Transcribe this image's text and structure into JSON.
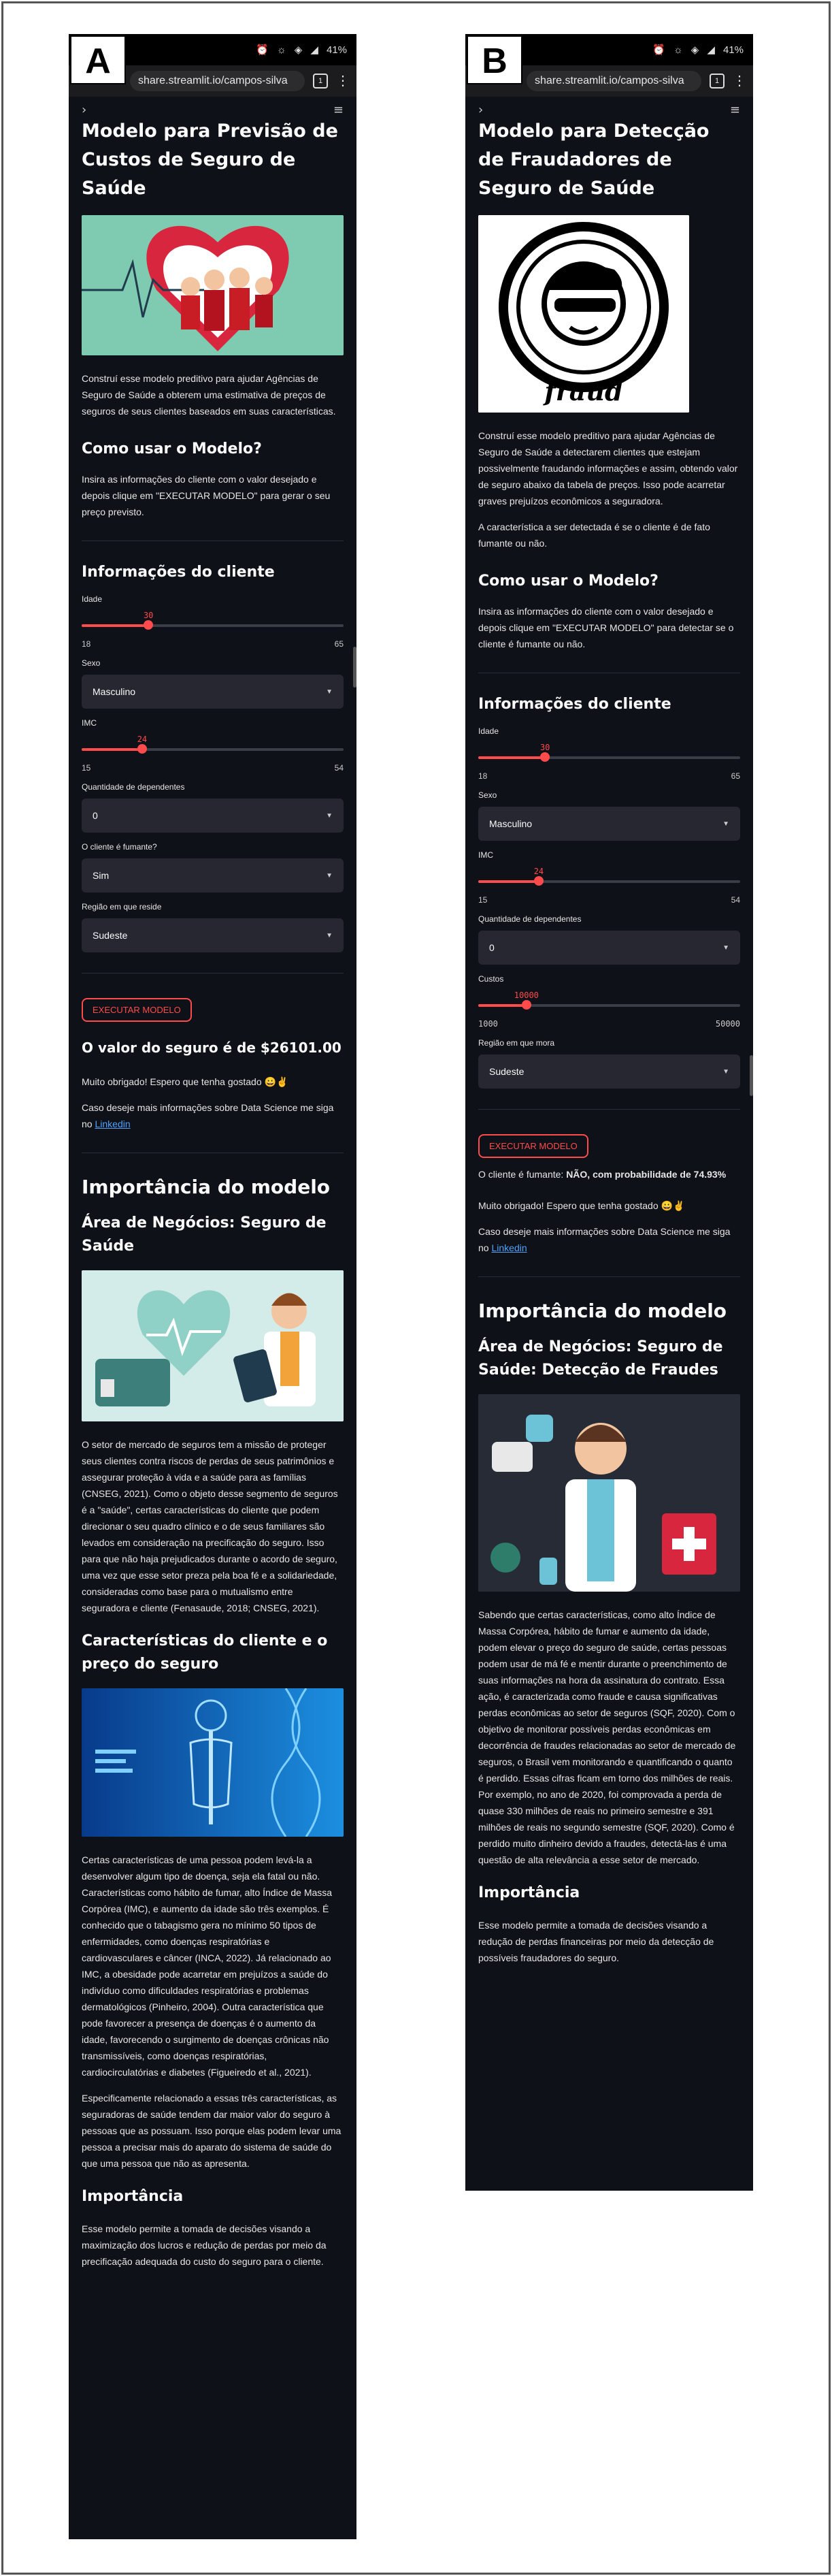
{
  "labels": {
    "a": "A",
    "b": "B"
  },
  "status": {
    "battery": "41%"
  },
  "browser": {
    "url": "share.streamlit.io/campos-silva",
    "tab_count": "1"
  },
  "a": {
    "title": "Modelo para Previsão de Custos de Seguro de Saúde",
    "intro": "Construí esse modelo preditivo para ajudar Agências de Seguro de Saúde a obterem uma estimativa de preços de seguros de seus clientes baseados em suas características.",
    "how_title": "Como usar o Modelo?",
    "how_text": "Insira as informações do cliente com o valor desejado e depois clique em \"EXECUTAR MODELO\" para gerar o seu preço previsto.",
    "info_title": "Informações do cliente",
    "age": {
      "label": "Idade",
      "value": "30",
      "min": "18",
      "max": "65",
      "fraction": 0.255
    },
    "sex": {
      "label": "Sexo",
      "value": "Masculino"
    },
    "bmi": {
      "label": "IMC",
      "value": "24",
      "min": "15",
      "max": "54",
      "fraction": 0.231
    },
    "deps": {
      "label": "Quantidade de dependentes",
      "value": "0"
    },
    "smoker": {
      "label": "O cliente é fumante?",
      "value": "Sim"
    },
    "region": {
      "label": "Região em que reside",
      "value": "Sudeste"
    },
    "button": "EXECUTAR MODELO",
    "result": "O valor do seguro é de $26101.00",
    "thanks": "Muito obrigado! Espero que tenha gostado 😀✌️",
    "more_prefix": "Caso deseje mais informações sobre Data Science me siga no ",
    "linkedin": "Linkedin",
    "importance_title": "Importância do modelo",
    "area_title": "Área de Negócios: Seguro de Saúde",
    "area_text": "O setor de mercado de seguros tem a missão de proteger seus clientes contra riscos de perdas de seus patrimônios e assegurar proteção à vida e a saúde para as famílias (CNSEG, 2021). Como o objeto desse segmento de seguros é a \"saúde\", certas características do cliente que podem direcionar o seu quadro clínico e o de seus familiares são levados em consideração na precificação do seguro. Isso para que não haja prejudicados durante o acordo de seguro, uma vez que esse setor preza pela boa fé e a solidariedade, consideradas como base para o mutualismo entre seguradora e cliente (Fenasaude, 2018; CNSEG, 2021).",
    "chars_title": "Características do cliente e o preço do seguro",
    "chars_text1": "Certas características de uma pessoa podem levá-la a desenvolver algum tipo de doença, seja ela fatal ou não. Características como hábito de fumar, alto Índice de Massa Corpórea (IMC), e aumento da idade são três exemplos. É conhecido que o tabagismo gera no mínimo 50 tipos de enfermidades, como doenças respiratórias e cardiovasculares e câncer (INCA, 2022). Já relacionado ao IMC, a obesidade pode acarretar em prejuízos a saúde do indivíduo como dificuldades respiratórias e problemas dermatológicos (Pinheiro, 2004). Outra característica que pode favorecer a presença de doenças é o aumento da idade, favorecendo o surgimento de doenças crônicas não transmissíveis, como doenças respiratórias, cardiocirculatórias e diabetes (Figueiredo et al., 2021).",
    "chars_text2": "Especificamente relacionado a essas três características, as seguradoras de saúde tendem dar maior valor do seguro à pessoas que as possuam. Isso porque elas podem levar uma pessoa a precisar mais do aparato do sistema de saúde do que uma pessoa que não as apresenta.",
    "imp_title": "Importância",
    "imp_text": "Esse modelo permite a tomada de decisões visando a maximização dos lucros e redução de perdas por meio da precificação adequada do custo do seguro para o cliente."
  },
  "b": {
    "title": "Modelo para Detecção de Fraudadores de Seguro de Saúde",
    "fraud_word": "fraud",
    "intro": "Construí esse modelo preditivo para ajudar Agências de Seguro de Saúde a detectarem clientes que estejam possivelmente fraudando informações e assim, obtendo valor de seguro abaixo da tabela de preços. Isso pode acarretar graves prejuízos econômicos a seguradora.",
    "intro2": "A característica a ser detectada é se o cliente é de fato fumante ou não.",
    "how_title": "Como usar o Modelo?",
    "how_text": "Insira as informações do cliente com o valor desejado e depois clique em \"EXECUTAR MODELO\" para detectar se o cliente é fumante ou não.",
    "info_title": "Informações do cliente",
    "age": {
      "label": "Idade",
      "value": "30",
      "min": "18",
      "max": "65",
      "fraction": 0.255
    },
    "sex": {
      "label": "Sexo",
      "value": "Masculino"
    },
    "bmi": {
      "label": "IMC",
      "value": "24",
      "min": "15",
      "max": "54",
      "fraction": 0.231
    },
    "deps": {
      "label": "Quantidade de dependentes",
      "value": "0"
    },
    "cost": {
      "label": "Custos",
      "value": "10000",
      "min": "1000",
      "max": "50000",
      "fraction": 0.184
    },
    "region": {
      "label": "Região em que mora",
      "value": "Sudeste"
    },
    "button": "EXECUTAR MODELO",
    "result_prefix": "O cliente é fumante: ",
    "result_bold": "NÃO, com probabilidade de 74.93%",
    "thanks": "Muito obrigado! Espero que tenha gostado 😀✌️",
    "more_prefix": "Caso deseje mais informações sobre Data Science me siga no ",
    "linkedin": "Linkedin",
    "importance_title": "Importância do modelo",
    "area_title": "Área de Negócios: Seguro de Saúde: Detecção de Fraudes",
    "area_text": "Sabendo que certas características, como alto Índice de Massa Corpórea, hábito de fumar e aumento da idade, podem elevar o preço do seguro de saúde, certas pessoas podem usar de má fé e mentir durante o preenchimento de suas informações na hora da assinatura do contrato. Essa ação, é caracterizada como fraude e causa significativas perdas econômicas ao setor de seguros (SQF, 2020). Com o objetivo de monitorar possíveis perdas econômicas em decorrência de fraudes relacionadas ao setor de mercado de seguros, o Brasil vem monitorando e quantificando o quanto é perdido. Essas cifras ficam em torno dos milhões de reais. Por exemplo, no ano de 2020, foi comprovada a perda de quase 330 milhões de reais no primeiro semestre e 391 milhões de reais no segundo semestre (SQF, 2020). Como é perdido muito dinheiro devido a fraudes, detectá-las é uma questão de alta relevância a esse setor de mercado.",
    "imp_title": "Importância",
    "imp_text": "Esse modelo permite a tomada de decisões visando a redução de perdas financeiras por meio da detecção de possíveis fraudadores do seguro."
  }
}
